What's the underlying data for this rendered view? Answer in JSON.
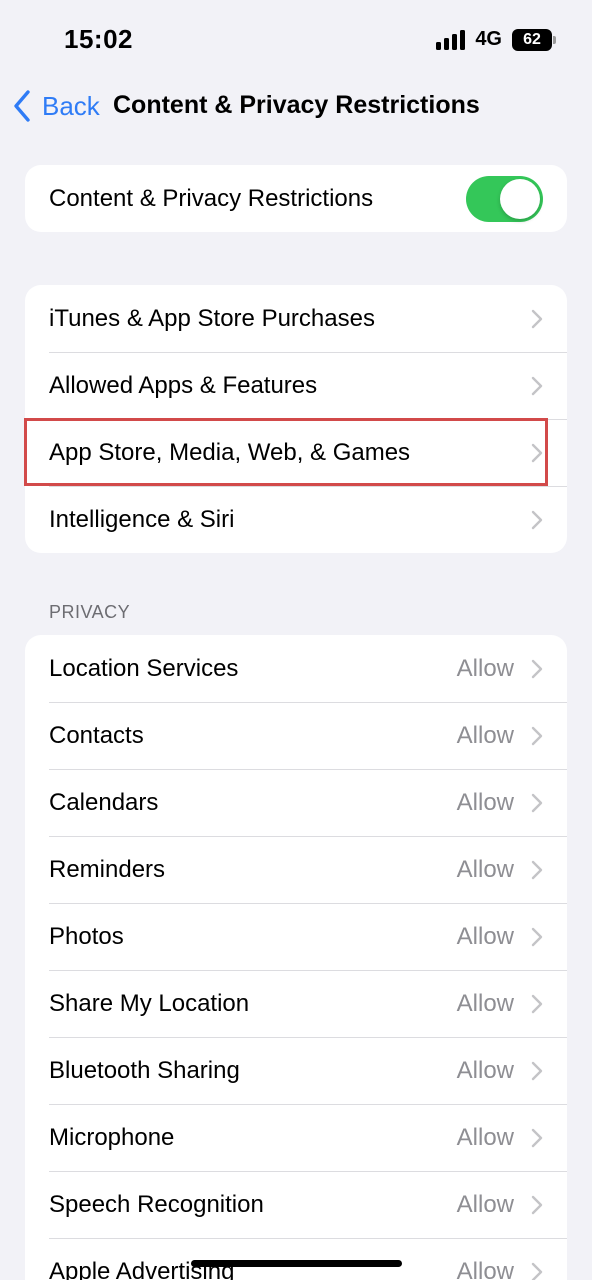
{
  "status": {
    "time": "15:02",
    "network": "4G",
    "battery": "62"
  },
  "nav": {
    "back_label": "Back",
    "title": "Content & Privacy Restrictions"
  },
  "master_toggle": {
    "label": "Content & Privacy Restrictions",
    "on": true
  },
  "menu": {
    "items": [
      {
        "label": "iTunes & App Store Purchases"
      },
      {
        "label": "Allowed Apps & Features"
      },
      {
        "label": "App Store, Media, Web, & Games"
      },
      {
        "label": "Intelligence & Siri"
      }
    ]
  },
  "privacy": {
    "header": "PRIVACY",
    "items": [
      {
        "label": "Location Services",
        "value": "Allow"
      },
      {
        "label": "Contacts",
        "value": "Allow"
      },
      {
        "label": "Calendars",
        "value": "Allow"
      },
      {
        "label": "Reminders",
        "value": "Allow"
      },
      {
        "label": "Photos",
        "value": "Allow"
      },
      {
        "label": "Share My Location",
        "value": "Allow"
      },
      {
        "label": "Bluetooth Sharing",
        "value": "Allow"
      },
      {
        "label": "Microphone",
        "value": "Allow"
      },
      {
        "label": "Speech Recognition",
        "value": "Allow"
      },
      {
        "label": "Apple Advertising",
        "value": "Allow"
      }
    ]
  },
  "colors": {
    "accent": "#2f7cf6",
    "toggle_on": "#34c759",
    "highlight": "#d24a4a"
  },
  "icons": {
    "back": "chevron-left-icon",
    "row": "chevron-right-icon",
    "signal": "cellular-signal-icon",
    "battery": "battery-icon"
  }
}
